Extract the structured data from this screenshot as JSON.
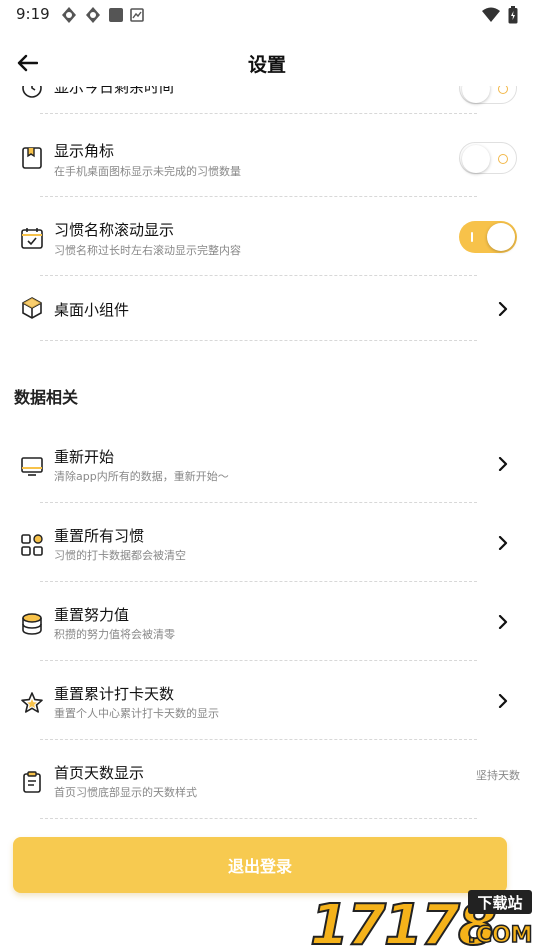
{
  "status_bar": {
    "time": "9:19"
  },
  "app_bar": {
    "title": "设置"
  },
  "settings": {
    "partial_row": {
      "title": "显示今日剩余时间",
      "toggle_on": false
    },
    "badge": {
      "title": "显示角标",
      "desc": "在手机桌面图标显示未完成的习惯数量",
      "toggle_on": false
    },
    "marquee": {
      "title": "习惯名称滚动显示",
      "desc": "习惯名称过长时左右滚动显示完整内容",
      "toggle_on": true
    },
    "widget": {
      "title": "桌面小组件"
    }
  },
  "data_section": {
    "header": "数据相关",
    "restart": {
      "title": "重新开始",
      "desc": "清除app内所有的数据，重新开始～"
    },
    "reset_habits": {
      "title": "重置所有习惯",
      "desc": "习惯的打卡数据都会被清空"
    },
    "reset_effort": {
      "title": "重置努力值",
      "desc": "积攒的努力值将会被清零"
    },
    "reset_days": {
      "title": "重置累计打卡天数",
      "desc": "重置个人中心累计打卡天数的显示"
    },
    "home_days": {
      "title": "首页天数显示",
      "desc": "首页习惯底部显示的天数样式",
      "value": "坚持天数"
    }
  },
  "logout": {
    "label": "退出登录"
  },
  "watermark": {
    "number": "17178",
    "site_text": "下载站",
    "domain": ".COM"
  },
  "colors": {
    "accent": "#f7c24a",
    "logout": "#f7ca50"
  }
}
